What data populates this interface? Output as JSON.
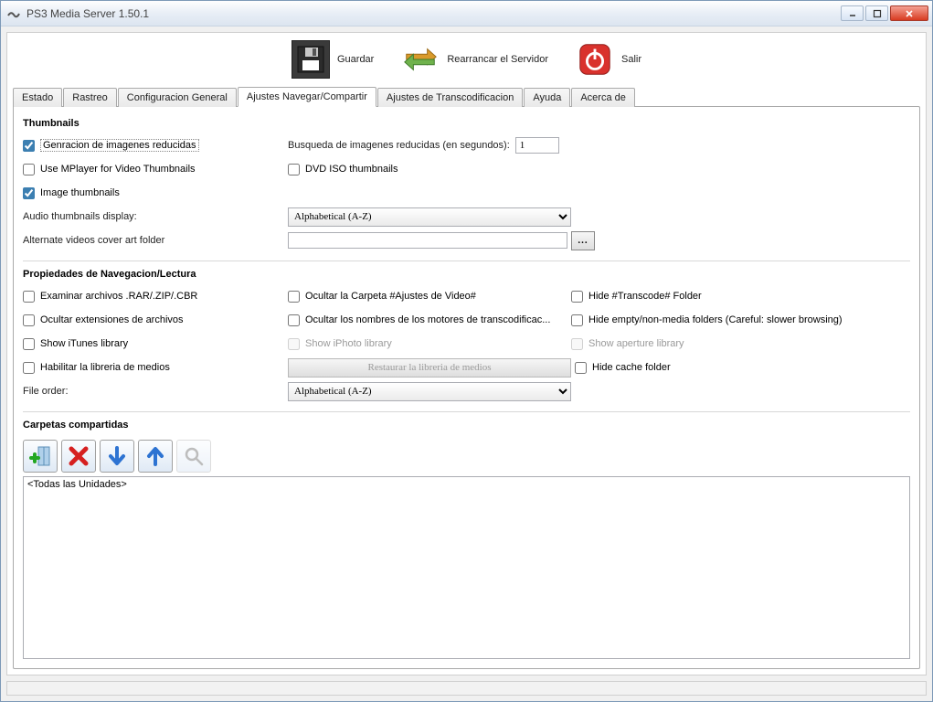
{
  "window": {
    "title": "PS3 Media Server 1.50.1"
  },
  "toolbar": {
    "save": "Guardar",
    "restart": "Rearrancar el Servidor",
    "quit": "Salir"
  },
  "tabs": [
    "Estado",
    "Rastreo",
    "Configuracion General",
    "Ajustes Navegar/Compartir",
    "Ajustes de Transcodificacion",
    "Ayuda",
    "Acerca de"
  ],
  "active_tab": 3,
  "thumbnails": {
    "heading": "Thumbnails",
    "gen_reduced": {
      "label": "Genracion de imagenes reducidas",
      "checked": true
    },
    "seek_label": "Busqueda de imagenes reducidas (en segundos):",
    "seek_value": "1",
    "mplayer": {
      "label": "Use MPlayer for Video Thumbnails",
      "checked": false
    },
    "dvd_iso": {
      "label": "DVD ISO thumbnails",
      "checked": false
    },
    "image_thumbs": {
      "label": "Image thumbnails",
      "checked": true
    },
    "audio_display_label": "Audio thumbnails display:",
    "audio_display_value": "Alphabetical (A-Z)",
    "alt_folder_label": "Alternate videos cover art folder",
    "alt_folder_value": "",
    "browse": "..."
  },
  "navigation": {
    "heading": "Propiedades de Navegacion/Lectura",
    "archives": {
      "label": "Examinar archivos .RAR/.ZIP/.CBR",
      "checked": false
    },
    "hide_video_settings": {
      "label": "Ocultar la Carpeta #Ajustes de Video#",
      "checked": false
    },
    "hide_transcode": {
      "label": "Hide #Transcode# Folder",
      "checked": false
    },
    "hide_ext": {
      "label": "Ocultar extensiones de archivos",
      "checked": false
    },
    "hide_engines": {
      "label": "Ocultar los nombres de los motores de transcodificac...",
      "checked": false
    },
    "hide_empty": {
      "label": "Hide empty/non-media folders (Careful: slower browsing)",
      "checked": false
    },
    "itunes": {
      "label": "Show iTunes library",
      "checked": false
    },
    "iphoto": {
      "label": "Show iPhoto library",
      "checked": false,
      "disabled": true
    },
    "aperture": {
      "label": "Show aperture library",
      "checked": false,
      "disabled": true
    },
    "enable_medialib": {
      "label": "Habilitar la libreria de medios",
      "checked": false
    },
    "reset_medialib": "Restaurar la libreria de medios",
    "hide_cache": {
      "label": "Hide cache folder",
      "checked": false
    },
    "file_order_label": "File order:",
    "file_order_value": "Alphabetical (A-Z)"
  },
  "shared": {
    "heading": "Carpetas compartidas",
    "entries": [
      "<Todas las Unidades>"
    ]
  }
}
